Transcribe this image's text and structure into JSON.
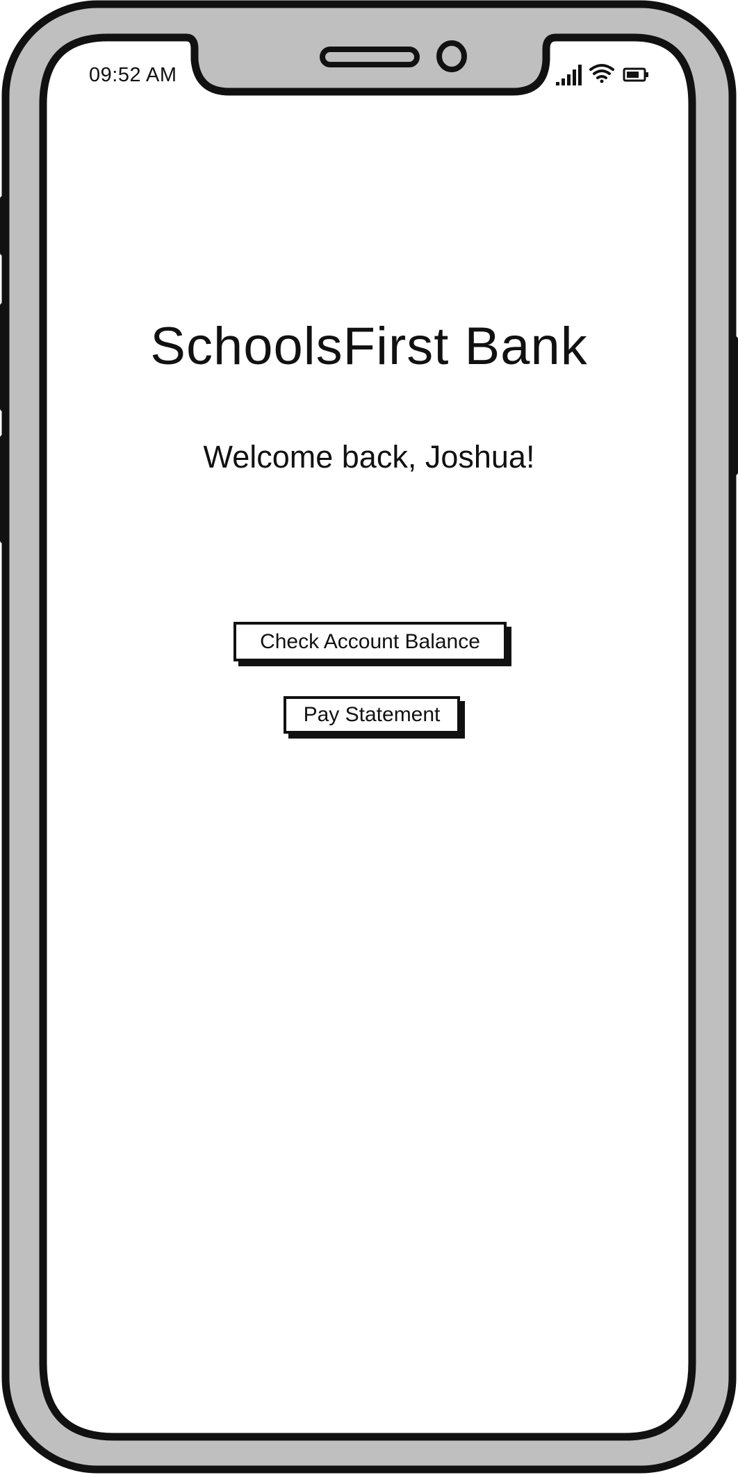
{
  "status_bar": {
    "time": "09:52 AM",
    "icons": [
      "signal-icon",
      "wifi-icon",
      "battery-icon"
    ]
  },
  "app": {
    "title": "SchoolsFirst Bank",
    "welcome": "Welcome back, Joshua!"
  },
  "actions": {
    "check_balance_label": "Check Account Balance",
    "pay_statement_label": "Pay Statement"
  },
  "colors": {
    "frame": "#bfbfbf",
    "outline": "#111111",
    "screen": "#ffffff"
  }
}
